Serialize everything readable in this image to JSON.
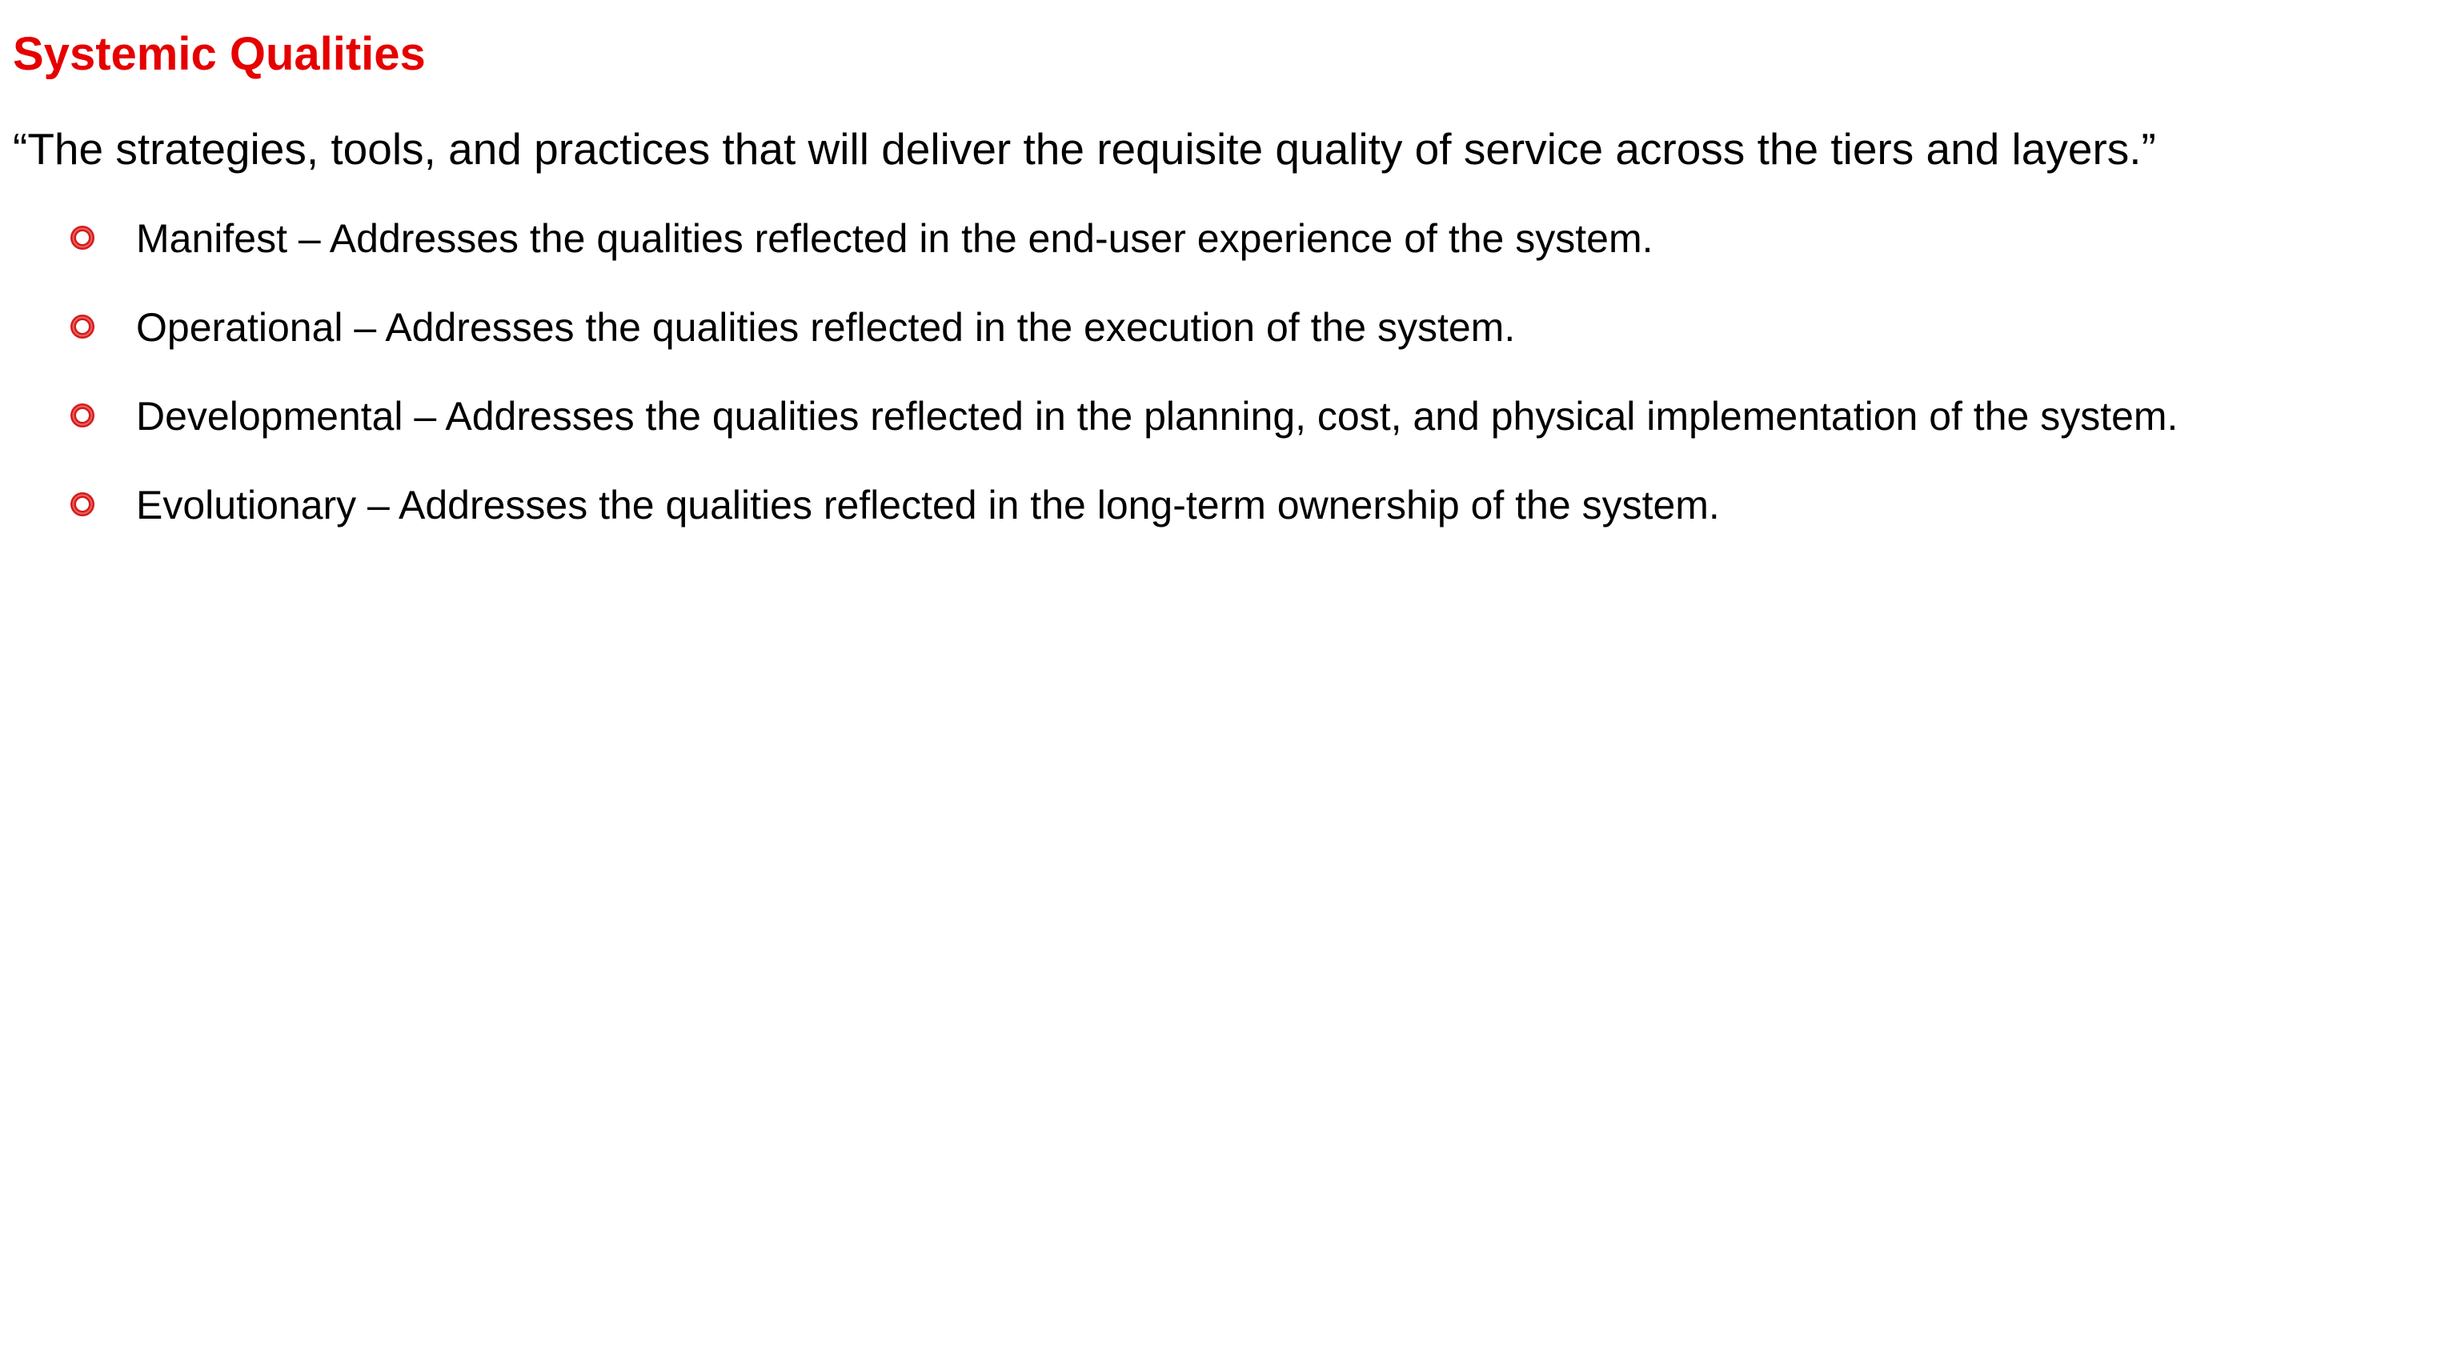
{
  "heading": {
    "title": "Systemic Qualities",
    "title_color": "#e60000"
  },
  "intro": {
    "quote": "“The strategies, tools, and practices that will deliver the requisite quality of service across the tiers and layers.”"
  },
  "bullets": {
    "marker_icon": "ring-bullet-icon",
    "marker_color": "#d71b1b",
    "items": [
      {
        "text": "Manifest – Addresses the qualities reflected in the end-user experience of the system."
      },
      {
        "text": "Operational – Addresses the qualities reflected in the execution of the system."
      },
      {
        "text": "Developmental – Addresses the qualities reflected in the planning, cost, and physical implementation of the system."
      },
      {
        "text": "Evolutionary – Addresses the qualities reflected in the long-term ownership of the system."
      }
    ]
  }
}
